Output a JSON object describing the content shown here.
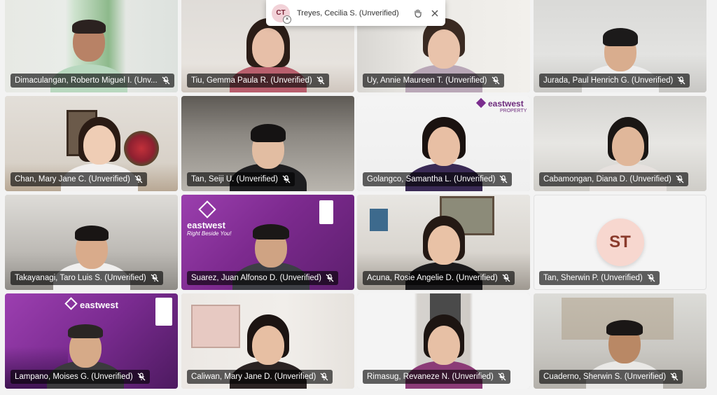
{
  "notification": {
    "initials": "CT",
    "name": "Treyes, Cecilia S. (Unverified)",
    "reaction_icon": "raise-hand-icon",
    "close_icon": "close-icon"
  },
  "participants": [
    {
      "name": "Dimaculangan, Roberto Miguel I. (Unv...",
      "muted": true
    },
    {
      "name": "Tiu, Gemma Paula R. (Unverified)",
      "muted": true
    },
    {
      "name": "Uy, Annie Maureen T. (Unverified)",
      "muted": true
    },
    {
      "name": "Jurada, Paul Henrich G. (Unverified)",
      "muted": true
    },
    {
      "name": "Chan, Mary Jane C. (Unverified)",
      "muted": true
    },
    {
      "name": "Tan, Seiji U. (Unverified)",
      "muted": true
    },
    {
      "name": "Golangco, Samantha L. (Unverified)",
      "muted": true
    },
    {
      "name": "Cabamongan, Diana D. (Unverified)",
      "muted": true
    },
    {
      "name": "Takayanagi, Taro Luis S. (Unverified)",
      "muted": true
    },
    {
      "name": "Suarez, Juan Alfonso D. (Unverified)",
      "muted": true
    },
    {
      "name": "Acuna, Rosie Angelie D. (Unverified)",
      "muted": true
    },
    {
      "name": "Tan, Sherwin P. (Unverified)",
      "muted": true,
      "avatar_initials": "ST"
    },
    {
      "name": "Lampano, Moises G. (Unverified)",
      "muted": true
    },
    {
      "name": "Caliwan, Mary Jane D. (Unverified)",
      "muted": true
    },
    {
      "name": "Rimasug, Revaneze N. (Unverified)",
      "muted": true
    },
    {
      "name": "Cuaderno, Sherwin S. (Unverified)",
      "muted": true
    }
  ],
  "backgrounds": {
    "eastwest_brand": "eastwest",
    "eastwest_tagline": "Right Beside You!",
    "eastwest_property_logo": "eastwest",
    "eastwest_property_sub": "PROPERTY"
  },
  "colors": {
    "brand_purple": "#7b2d8e",
    "label_bg": "rgba(0,0,0,0.62)"
  }
}
